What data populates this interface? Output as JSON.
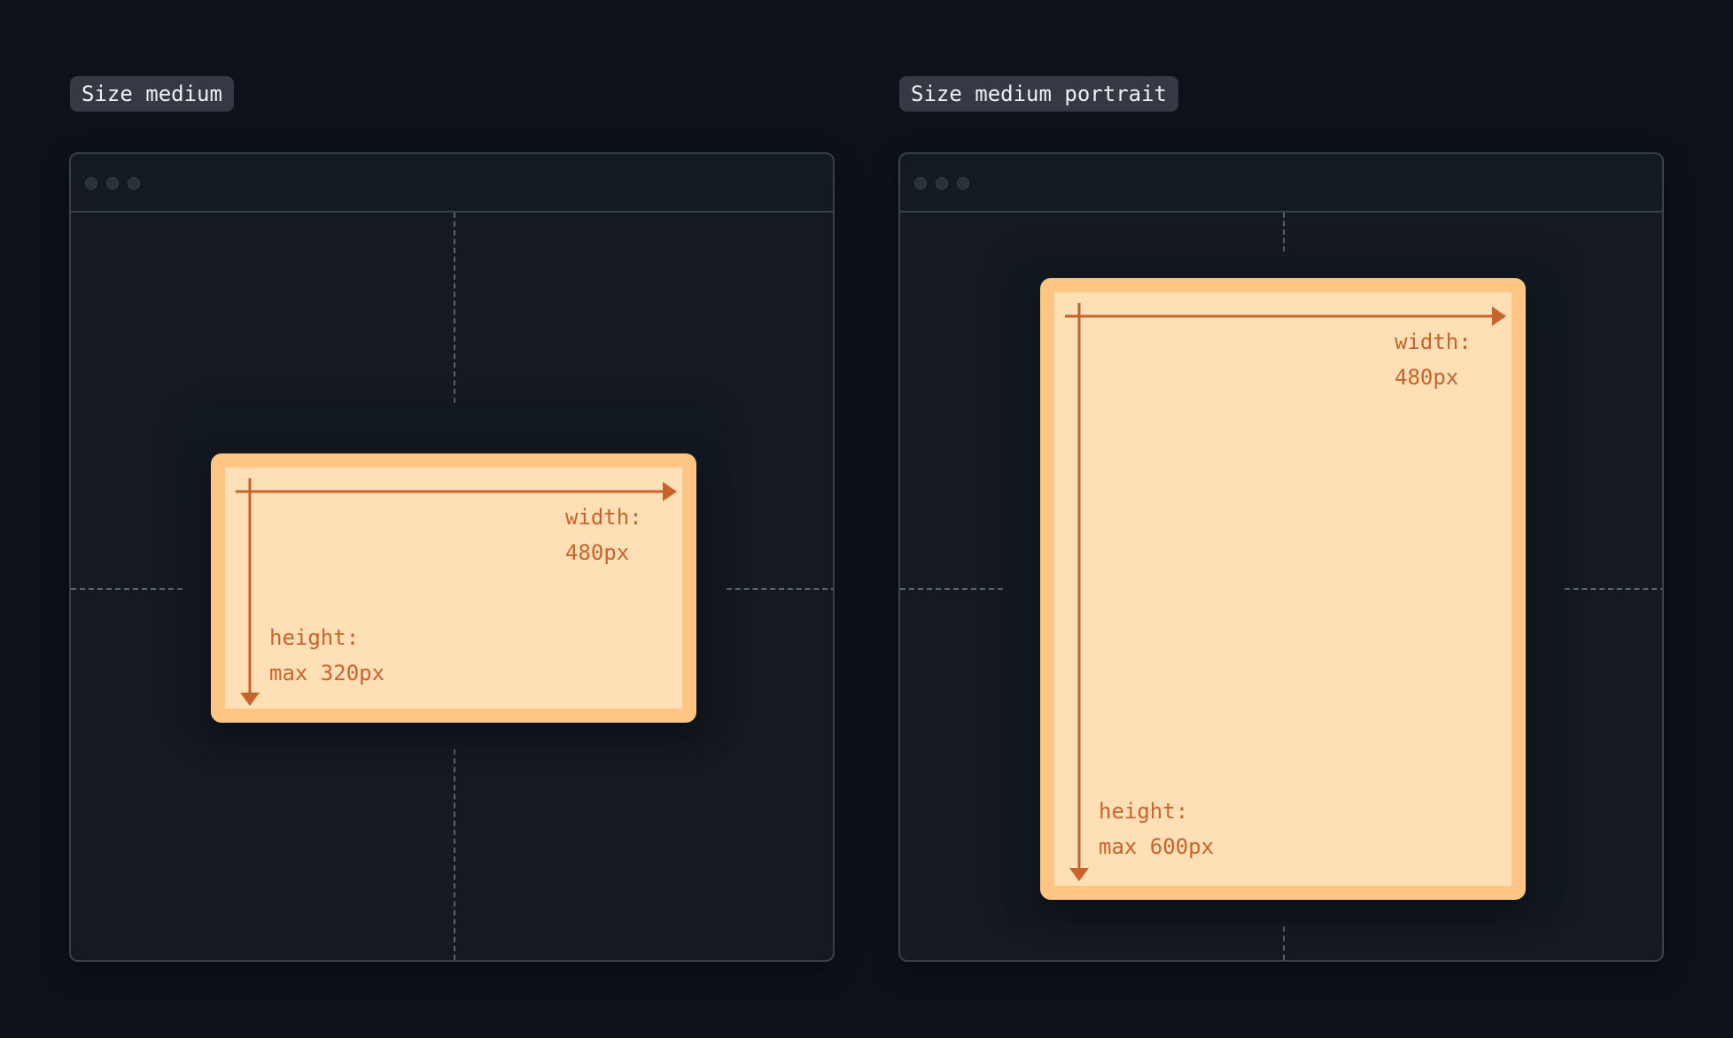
{
  "panels": [
    {
      "label": "Size medium",
      "width_label": "width:",
      "width_value": "480px",
      "height_label": "height:",
      "height_value": "max 320px"
    },
    {
      "label": "Size medium portrait",
      "width_label": "width:",
      "width_value": "480px",
      "height_label": "height:",
      "height_value": "max 600px"
    }
  ],
  "colors": {
    "background": "#0d1119",
    "window": "#151a22",
    "border": "#3a404a",
    "label_bg": "#343943",
    "sheet_outer": "#ffc582",
    "sheet_inner": "#ffdfb5",
    "accent": "#c7642b"
  }
}
